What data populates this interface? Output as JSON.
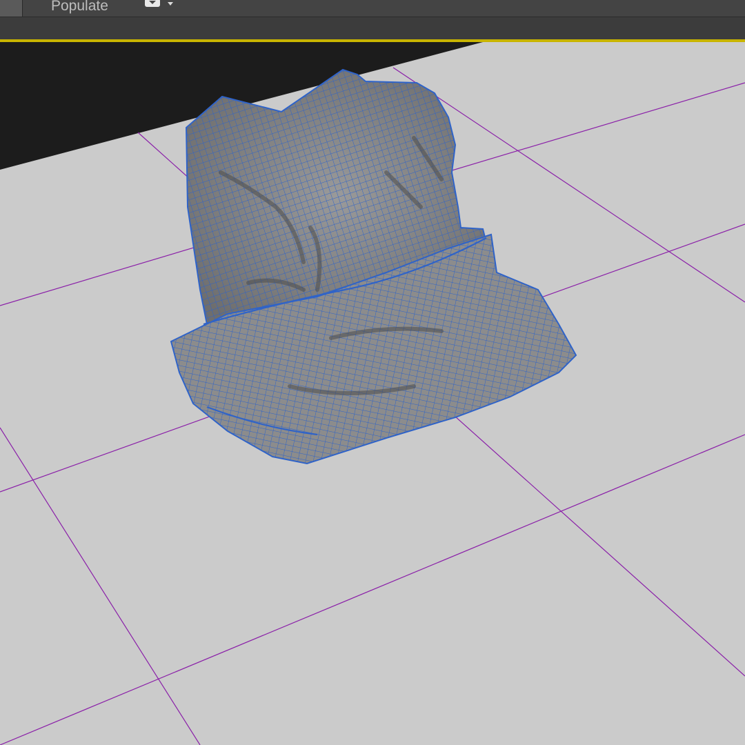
{
  "toolbar": {
    "tabs": [
      {
        "label": "Populate"
      }
    ],
    "dropdown_icon": "object-paint-dropdown-icon"
  },
  "viewport": {
    "object": "cloth-mesh",
    "colors": {
      "background": "#1c1c1c",
      "ground": "#cbcbcb",
      "grid": "#8a1fa8",
      "mesh_fill": "#8a8a8a",
      "wireframe": "#2f63c8",
      "active_border": "#c8b400"
    }
  }
}
